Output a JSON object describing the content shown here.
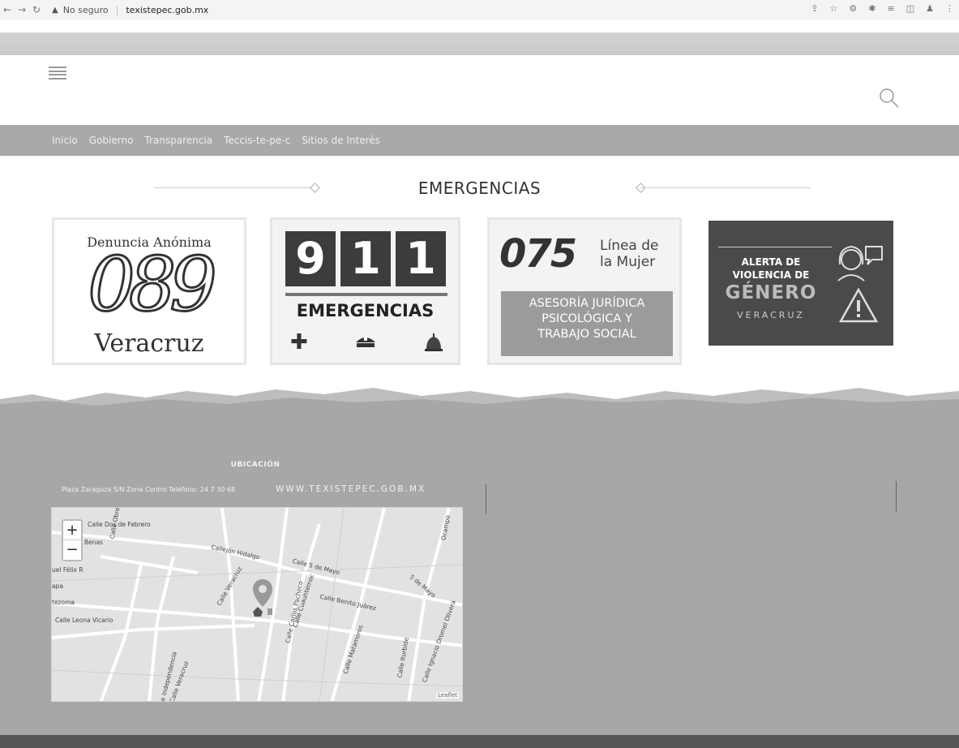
{
  "browser": {
    "security_label": "No seguro",
    "url": "texistepec.gob.mx"
  },
  "nav": {
    "items": [
      {
        "label": "Inicio"
      },
      {
        "label": "Gobierno"
      },
      {
        "label": "Transparencia"
      },
      {
        "label": "Teccis-te-pe-c"
      },
      {
        "label": "Sitios de Interés"
      }
    ]
  },
  "emergencias": {
    "title": "EMERGENCIAS",
    "card_089": {
      "top": "Denuncia Anónima",
      "number": "089",
      "bottom": "Veracruz"
    },
    "card_911": {
      "digits": [
        "9",
        "1",
        "1"
      ],
      "label": "EMERGENCIAS"
    },
    "card_075": {
      "number": "075",
      "side_line1": "Línea de",
      "side_line2": "la Mujer",
      "box_line1": "ASESORÍA JURÍDICA",
      "box_line2": "PSICOLÓGICA Y",
      "box_line3": "TRABAJO SOCIAL"
    },
    "card_alerta": {
      "line1": "ALERTA DE",
      "line2": "VIOLENCIA DE",
      "line3": "GÉNERO",
      "line4": "VERACRUZ"
    }
  },
  "footer": {
    "location_title": "UBICACIÓN",
    "address": "Plaza Zaragoza S/N Zona Centro Teléfono: 24 7 30 68",
    "website": "WWW.TEXISTEPEC.GOB.MX"
  },
  "map": {
    "zoom_in": "+",
    "zoom_out": "−",
    "attribution": "Leaflet",
    "streets": [
      "Calle Dos de Febrero",
      "Callejón Hidalgo",
      "Calle 5 de Mayo",
      "5 de Mayo",
      "Calle Benito Juárez",
      "Calle Veracruz",
      "Calle Cuauhtémoc",
      "Calle Carlos Pacheco",
      "Calle Leona Vicario",
      "Calle Matamoros",
      "Calle Iturbide",
      "Calle Ignacio Dromel Olivera",
      "Calle Independencia",
      "Calle Veracruz",
      "Benas",
      "uel Félix R",
      "apa",
      "tezoma",
      "Ocampo",
      "Calle Obreg"
    ]
  }
}
